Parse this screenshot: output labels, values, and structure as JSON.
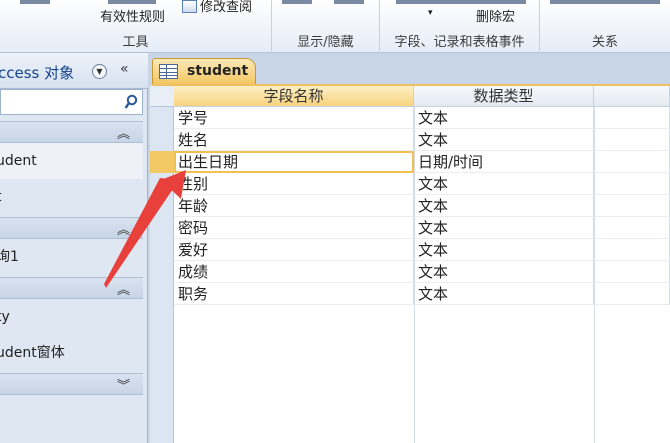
{
  "ribbon": {
    "validation_rule_label": "有效性规则",
    "modify_lookup_label": "修改查阅",
    "delete_macro_label": "删除宏",
    "groups": {
      "tools": "工具",
      "show_hide": "显示/隐藏",
      "field_events": "字段、记录和表格事件",
      "relations": "关系"
    }
  },
  "nav": {
    "title": "ccess 对象",
    "search_placeholder": "",
    "items": {
      "table_student": "udent",
      "table_t": "t",
      "query": "询1",
      "form_ty": "ty",
      "form_student": "udent窗体"
    }
  },
  "document": {
    "tab_label": "student",
    "columns": {
      "field_name": "字段名称",
      "data_type": "数据类型"
    },
    "rows": [
      {
        "name": "学号",
        "type": "文本"
      },
      {
        "name": "姓名",
        "type": "文本"
      },
      {
        "name": "出生日期",
        "type": "日期/时间"
      },
      {
        "name": "性别",
        "type": "文本"
      },
      {
        "name": "年龄",
        "type": "文本"
      },
      {
        "name": "密码",
        "type": "文本"
      },
      {
        "name": "爱好",
        "type": "文本"
      },
      {
        "name": "成绩",
        "type": "文本"
      },
      {
        "name": "职务",
        "type": "文本"
      }
    ],
    "selected_row": 2
  },
  "colors": {
    "accent": "#f3c763",
    "arrow": "#e8403a",
    "nav_bg": "#dfe7f2",
    "title_blue": "#15428b"
  }
}
